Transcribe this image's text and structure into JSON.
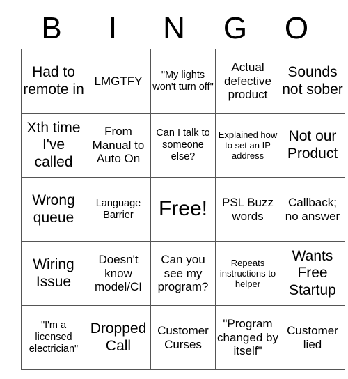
{
  "header": {
    "letters": [
      "B",
      "I",
      "N",
      "G",
      "O"
    ]
  },
  "grid": {
    "columns": 5,
    "rows": 5,
    "cells": [
      [
        {
          "text": "Had to remote in",
          "size": "sz-lg"
        },
        {
          "text": "LMGTFY",
          "size": "sz-md"
        },
        {
          "text": "\"My lights won't turn off\"",
          "size": "sz-sm"
        },
        {
          "text": "Actual defective product",
          "size": "sz-md"
        },
        {
          "text": "Sounds not sober",
          "size": "sz-lg"
        }
      ],
      [
        {
          "text": "Xth time I've called",
          "size": "sz-lg"
        },
        {
          "text": "From Manual to Auto On",
          "size": "sz-md"
        },
        {
          "text": "Can I talk to someone else?",
          "size": "sz-sm"
        },
        {
          "text": "Explained how to set an IP address",
          "size": "sz-xs"
        },
        {
          "text": "Not our Product",
          "size": "sz-lg"
        }
      ],
      [
        {
          "text": "Wrong queue",
          "size": "sz-lg"
        },
        {
          "text": "Language Barrier",
          "size": "sz-sm"
        },
        {
          "text": "Free!",
          "size": "sz-xl"
        },
        {
          "text": "PSL Buzz words",
          "size": "sz-md"
        },
        {
          "text": "Callback; no answer",
          "size": "sz-md"
        }
      ],
      [
        {
          "text": "Wiring Issue",
          "size": "sz-lg"
        },
        {
          "text": "Doesn't know model/CI",
          "size": "sz-md"
        },
        {
          "text": "Can you see my program?",
          "size": "sz-md"
        },
        {
          "text": "Repeats instructions to helper",
          "size": "sz-xs"
        },
        {
          "text": "Wants Free Startup",
          "size": "sz-lg"
        }
      ],
      [
        {
          "text": "\"I'm a licensed electrician\"",
          "size": "sz-sm"
        },
        {
          "text": "Dropped Call",
          "size": "sz-lg"
        },
        {
          "text": "Customer Curses",
          "size": "sz-md"
        },
        {
          "text": "\"Program changed by itself\"",
          "size": "sz-md"
        },
        {
          "text": "Customer lied",
          "size": "sz-md"
        }
      ]
    ]
  },
  "colors": {
    "background": "#ffffff",
    "text": "#000000",
    "border": "#555555"
  }
}
